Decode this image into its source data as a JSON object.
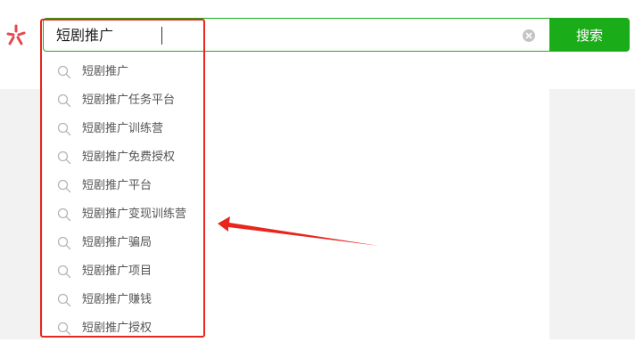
{
  "search": {
    "query": "短剧推广",
    "button_label": "搜索"
  },
  "suggestions": [
    "短剧推广",
    "短剧推广任务平台",
    "短剧推广训练营",
    "短剧推广免费授权",
    "短剧推广平台",
    "短剧推广变现训练营",
    "短剧推广骗局",
    "短剧推广项目",
    "短剧推广赚钱",
    "短剧推广授权"
  ],
  "colors": {
    "accent_green": "#1aad19",
    "annotation_red": "#e8261e",
    "logo_red": "#e5484d"
  },
  "icons": {
    "logo": "logo-icon",
    "clear": "clear-icon",
    "suggestion": "search-icon",
    "annotation": "arrow-icon"
  }
}
